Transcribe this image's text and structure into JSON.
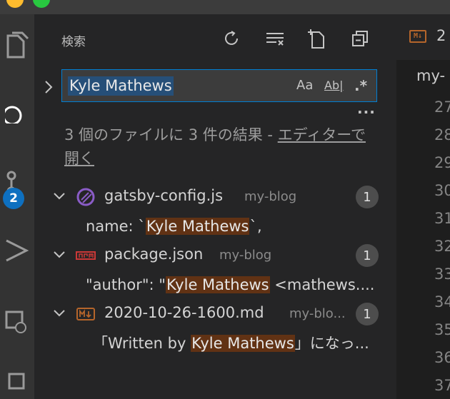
{
  "sidebar": {
    "title": "検索"
  },
  "search": {
    "value": "Kyle Mathews",
    "match_case_label": "Aa",
    "whole_word_label": "Ab|",
    "regex_label": ".*",
    "more_label": "···"
  },
  "summary": {
    "text": "3 個のファイルに 3 件の結果 - ",
    "link": "エディターで開く"
  },
  "results": [
    {
      "file": "gatsby-config.js",
      "dir": "my-blog",
      "count": "1",
      "match_before": "name: `",
      "match": "Kyle Mathews",
      "match_after": "`,"
    },
    {
      "file": "package.json",
      "dir": "my-blog",
      "count": "1",
      "match_before": "\"author\": \"",
      "match": "Kyle Mathews",
      "match_after": " <mathews...."
    },
    {
      "file": "2020-10-26-1600.md",
      "dir": "my-blo...",
      "count": "1",
      "match_before": "「Written by ",
      "match": "Kyle Mathews",
      "match_after": "」になっ..."
    }
  ],
  "activity": {
    "badge": "2"
  },
  "editor": {
    "tab_icon": "M↓",
    "tab_label": "2",
    "breadcrumb": "my-",
    "line_numbers": [
      "27",
      "28",
      "29",
      "30",
      "31",
      "32",
      "33",
      "34",
      "35",
      "36",
      "37"
    ]
  },
  "colors": {
    "accent": "#007fd4",
    "match_highlight": "#613214",
    "badge": "#0e70c0"
  }
}
